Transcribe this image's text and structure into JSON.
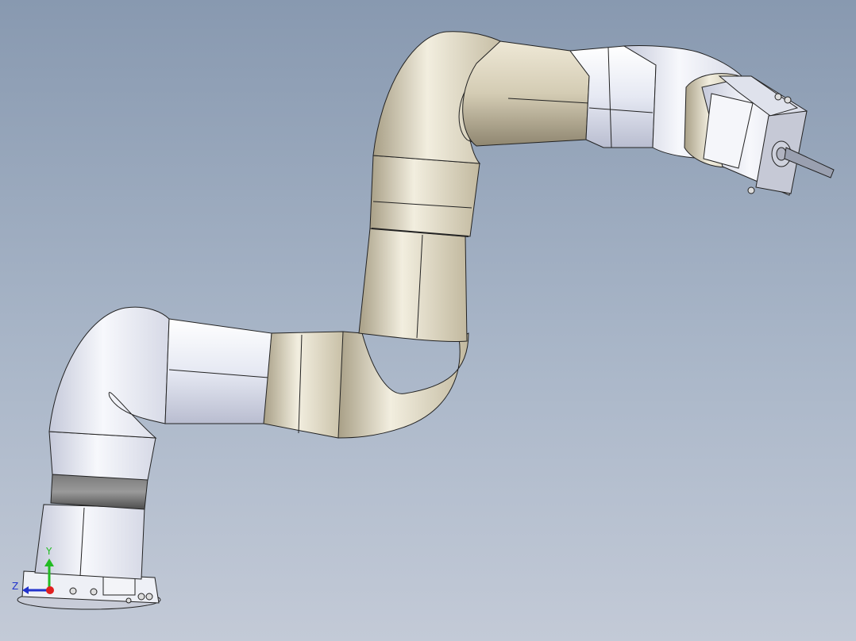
{
  "viewport": {
    "background_top": "#8899b0",
    "background_bottom": "#c3cad7"
  },
  "model": {
    "white_link_color": "#e6e9f3",
    "gold_link_color": "#d4ccb4",
    "dark_band_color": "#5f5f5f"
  },
  "triad": {
    "y_label": "Y",
    "z_label": "Z",
    "y_color": "#22bb22",
    "z_color": "#2233cc",
    "origin_color": "#e02020"
  }
}
